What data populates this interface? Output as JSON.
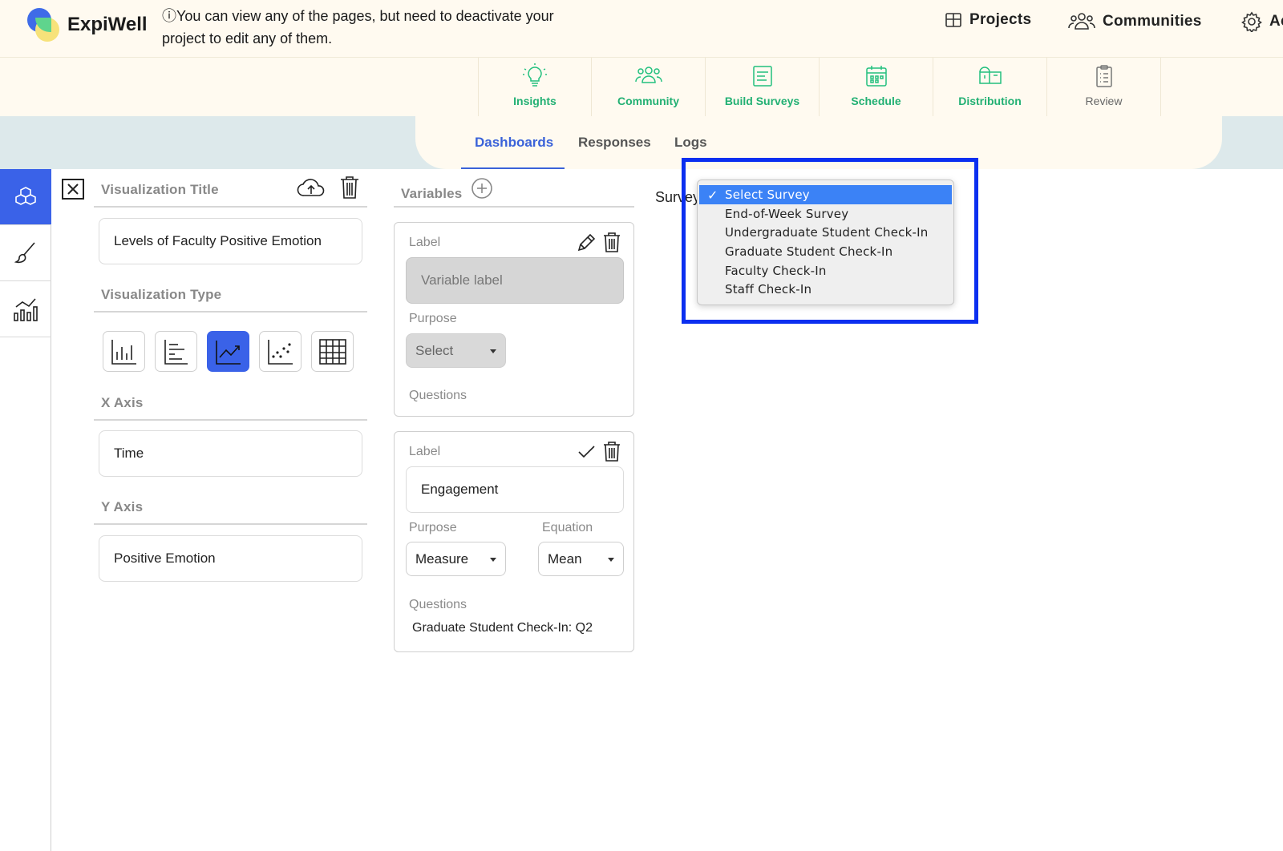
{
  "app": {
    "brand": "ExpiWell",
    "notice": "ⓘYou can view any of the pages, but need to deactivate your project to edit any of them."
  },
  "top_nav": {
    "projects": "Projects",
    "communities": "Communities",
    "account_partial": "Ac"
  },
  "modules": [
    {
      "label": "Insights",
      "icon": "lightbulb-icon"
    },
    {
      "label": "Community",
      "icon": "people-icon"
    },
    {
      "label": "Build Surveys",
      "icon": "form-icon"
    },
    {
      "label": "Schedule",
      "icon": "calendar-icon"
    },
    {
      "label": "Distribution",
      "icon": "mailbox-icon"
    },
    {
      "label": "Review",
      "icon": "clipboard-icon"
    }
  ],
  "tabs": {
    "dashboards": "Dashboards",
    "responses": "Responses",
    "logs": "Logs",
    "active": "Dashboards"
  },
  "rail": [
    "cubes-icon",
    "brush-icon",
    "chart-icon"
  ],
  "viz": {
    "title_section": "Visualization Title",
    "title_value": "Levels of Faculty Positive Emotion",
    "type_section": "Visualization Type",
    "types": [
      "bar-chart-icon",
      "horizontal-bar-icon",
      "line-chart-icon",
      "scatter-icon",
      "table-icon"
    ],
    "selected_type": "line-chart-icon",
    "x_axis_section": "X Axis",
    "x_axis_value": "Time",
    "y_axis_section": "Y Axis",
    "y_axis_value": "Positive Emotion"
  },
  "variables": {
    "section": "Variables",
    "card1": {
      "label_caption": "Label",
      "label_placeholder": "Variable label",
      "purpose_caption": "Purpose",
      "purpose_value": "Select",
      "questions_caption": "Questions"
    },
    "card2": {
      "label_caption": "Label",
      "label_value": "Engagement",
      "purpose_caption": "Purpose",
      "purpose_value": "Measure",
      "equation_caption": "Equation",
      "equation_value": "Mean",
      "questions_caption": "Questions",
      "question_value": "Graduate Student Check-In: Q2"
    }
  },
  "survey": {
    "label": "Survey",
    "options": [
      "Select Survey",
      "End-of-Week Survey",
      "Undergraduate Student Check-In",
      "Graduate Student Check-In",
      "Faculty Check-In",
      "Staff Check-In"
    ],
    "selected": "Select Survey",
    "check": "✓"
  },
  "colors": {
    "accent": "#3a62e8",
    "module_green": "#22c07e",
    "highlight": "#0b2ff0",
    "header_bg": "#fffaf0",
    "band_bg": "#dde9eb"
  }
}
